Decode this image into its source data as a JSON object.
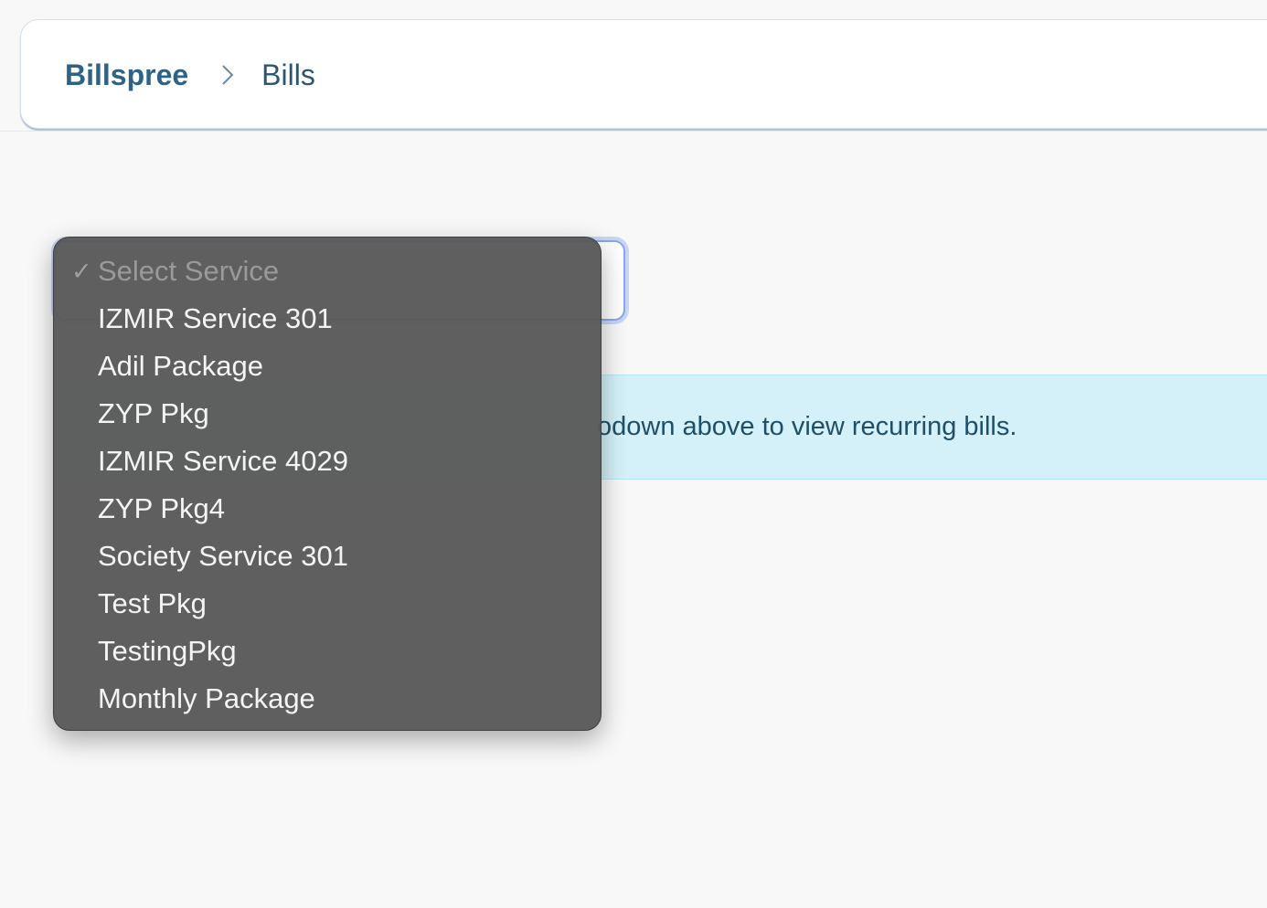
{
  "header": {
    "app_name": "Billspree",
    "current_page": "Bills",
    "separator_icon": "chevron-right-icon"
  },
  "info_alert": {
    "visible_text": "odown above to view recurring bills."
  },
  "service_select": {
    "selected_value": "Select Service",
    "options": [
      "Select Service",
      "IZMIR Service 301",
      "Adil Package",
      "ZYP Pkg",
      "IZMIR Service 4029",
      "ZYP Pkg4",
      "Society Service 301",
      "Test Pkg",
      "TestingPkg",
      "Monthly Package"
    ],
    "check_glyph": "✓",
    "check_icon": "checkmark-icon"
  },
  "colors": {
    "brand": "#2e6384",
    "alert_bg": "#d4f1f9",
    "menu_bg": "#585858",
    "focus_ring": "#8aa7ea"
  }
}
